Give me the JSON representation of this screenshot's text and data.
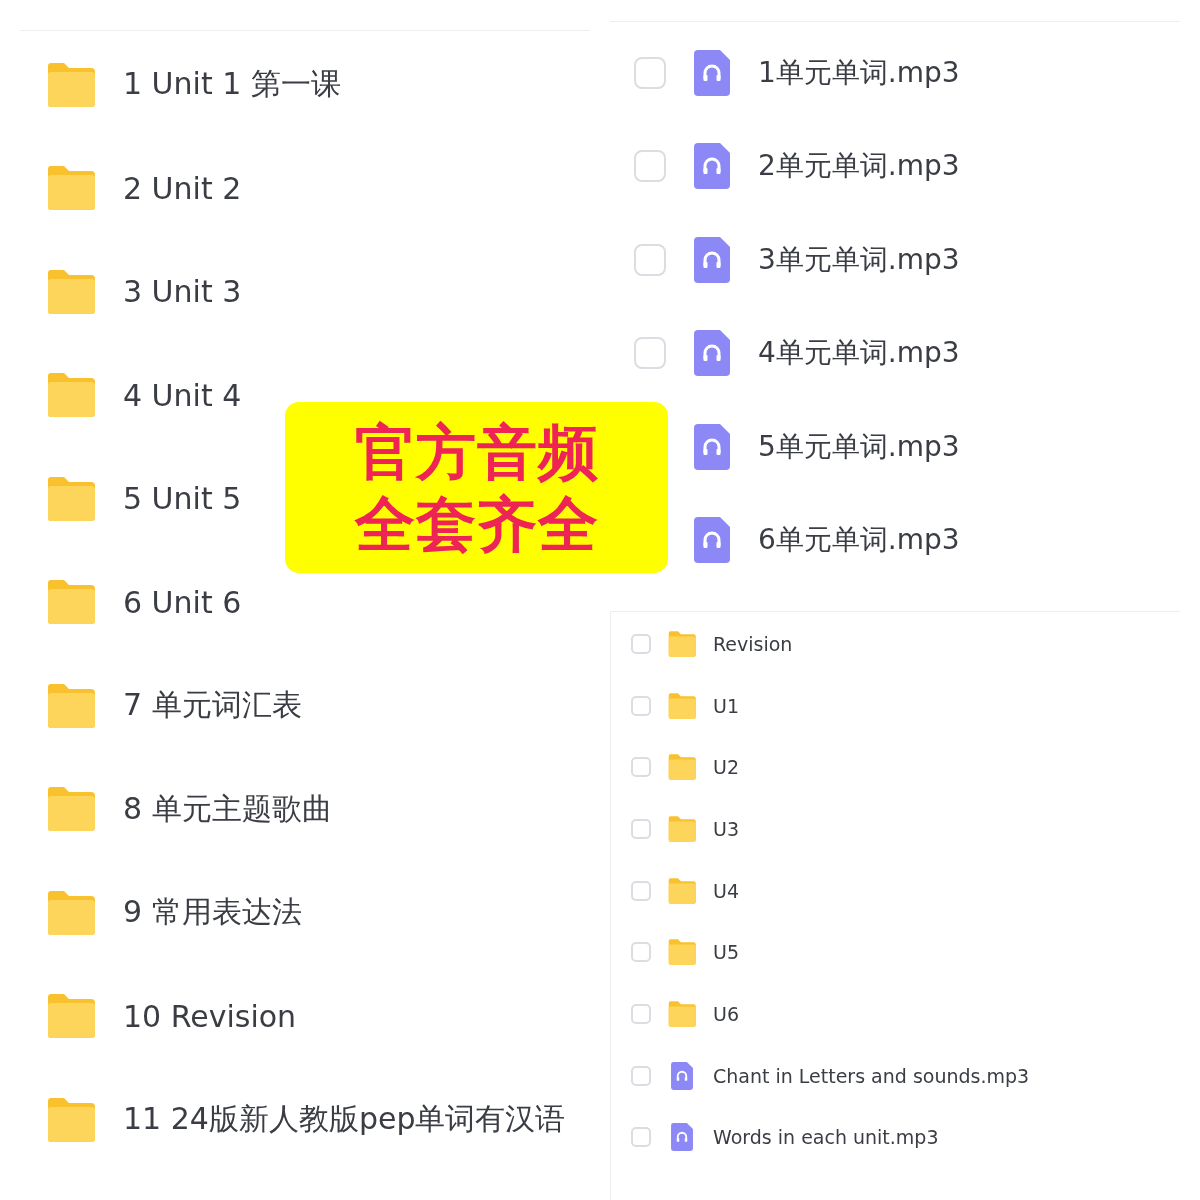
{
  "left_list": {
    "items": [
      {
        "kind": "folder",
        "name": "1 Unit 1 第一课"
      },
      {
        "kind": "folder",
        "name": "2 Unit 2"
      },
      {
        "kind": "folder",
        "name": "3 Unit 3"
      },
      {
        "kind": "folder",
        "name": "4 Unit 4"
      },
      {
        "kind": "folder",
        "name": "5 Unit 5"
      },
      {
        "kind": "folder",
        "name": "6 Unit 6"
      },
      {
        "kind": "folder",
        "name": "7 单元词汇表"
      },
      {
        "kind": "folder",
        "name": "8 单元主题歌曲"
      },
      {
        "kind": "folder",
        "name": "9 常用表达法"
      },
      {
        "kind": "folder",
        "name": "10 Revision"
      },
      {
        "kind": "folder",
        "name": "11 24版新人教版pep单词有汉语"
      }
    ]
  },
  "audio_list": {
    "items": [
      {
        "kind": "audio",
        "name": "1单元单词.mp3",
        "checked": false
      },
      {
        "kind": "audio",
        "name": "2单元单词.mp3",
        "checked": false
      },
      {
        "kind": "audio",
        "name": "3单元单词.mp3",
        "checked": false
      },
      {
        "kind": "audio",
        "name": "4单元单词.mp3",
        "checked": false
      },
      {
        "kind": "audio",
        "name": "5单元单词.mp3"
      },
      {
        "kind": "audio",
        "name": "6单元单词.mp3"
      }
    ]
  },
  "folder_list": {
    "items": [
      {
        "kind": "folder",
        "name": "Revision",
        "checked": false
      },
      {
        "kind": "folder",
        "name": "U1",
        "checked": false
      },
      {
        "kind": "folder",
        "name": "U2",
        "checked": false
      },
      {
        "kind": "folder",
        "name": "U3",
        "checked": false
      },
      {
        "kind": "folder",
        "name": "U4",
        "checked": false
      },
      {
        "kind": "folder",
        "name": "U5",
        "checked": false
      },
      {
        "kind": "folder",
        "name": "U6",
        "checked": false
      },
      {
        "kind": "audio",
        "name": "Chant in Letters and sounds.mp3",
        "checked": false
      },
      {
        "kind": "audio",
        "name": "Words in each unit.mp3",
        "checked": false
      }
    ]
  },
  "banner": {
    "lines": [
      "官方音频",
      "全套齐全"
    ]
  }
}
